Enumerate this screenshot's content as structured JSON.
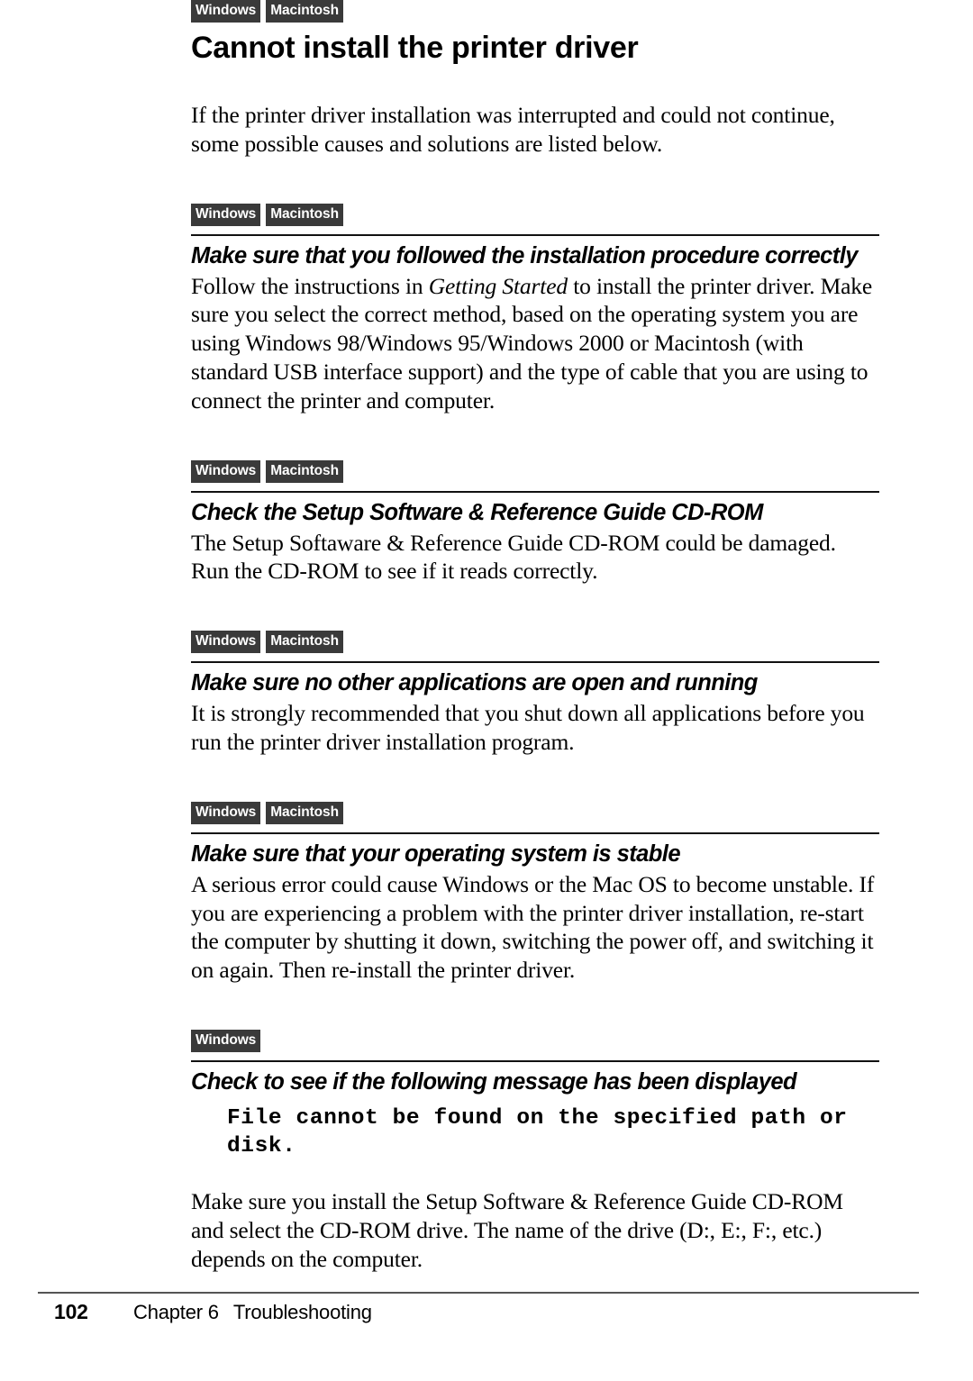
{
  "document": {
    "page_number": "102",
    "footer_chapter": "Chapter 6",
    "footer_chapter_title": "Troubleshooting"
  },
  "colors": {
    "badge_background": "#3a3a3a",
    "badge_text": "#ffffff",
    "rule": "#111111",
    "footer_rule": "#555555",
    "text": "#000000",
    "page_background": "#ffffff"
  },
  "badges": {
    "windows": "Windows",
    "macintosh": "Macintosh"
  },
  "title": {
    "badges": [
      "Windows",
      "Macintosh"
    ],
    "text": "Cannot install the printer driver"
  },
  "intro": {
    "text": "If the printer driver installation was interrupted and could not continue, some possible causes and solutions are listed below."
  },
  "sections": [
    {
      "badges": [
        "Windows",
        "Macintosh"
      ],
      "heading": "Make sure that you followed the installation procedure correctly",
      "body_parts": [
        {
          "text": "Follow the instructions in ",
          "style": "normal"
        },
        {
          "text": "Getting Started",
          "style": "italic"
        },
        {
          "text": " to install the printer driver. Make sure you select the correct method, based on the operating system you are using Windows 98/Windows 95/Windows 2000 or Macintosh (with standard USB interface support) and the type of cable that you are using to connect the printer and computer.",
          "style": "normal"
        }
      ]
    },
    {
      "badges": [
        "Windows",
        "Macintosh"
      ],
      "heading": "Check the Setup Software & Reference Guide CD-ROM",
      "body_parts": [
        {
          "text": "The Setup Softaware & Reference Guide CD-ROM could be damaged. Run the CD-ROM to see if it reads correctly.",
          "style": "normal"
        }
      ]
    },
    {
      "badges": [
        "Windows",
        "Macintosh"
      ],
      "heading": "Make sure no other applications are open and running",
      "body_parts": [
        {
          "text": "It is strongly recommended that you shut down all applications before you run the printer driver installation program.",
          "style": "normal"
        }
      ]
    },
    {
      "badges": [
        "Windows",
        "Macintosh"
      ],
      "heading": "Make sure that your operating system is stable",
      "body_parts": [
        {
          "text": "A serious error could cause Windows or the Mac OS to become unstable. If you are experiencing a problem with the printer driver installation, re-start the computer by shutting it down, switching the power off, and switching it on again. Then re-install the printer driver.",
          "style": "normal"
        }
      ]
    },
    {
      "badges": [
        "Windows"
      ],
      "heading": "Check to see if the following message has been displayed",
      "message": "File cannot be found on the specified path or disk.",
      "body_parts": [
        {
          "text": "Make sure you install the Setup Software & Reference Guide CD-ROM and select the CD-ROM drive.  The name of the drive (D:, E:, F:, etc.) depends on the computer.",
          "style": "normal"
        }
      ]
    }
  ]
}
